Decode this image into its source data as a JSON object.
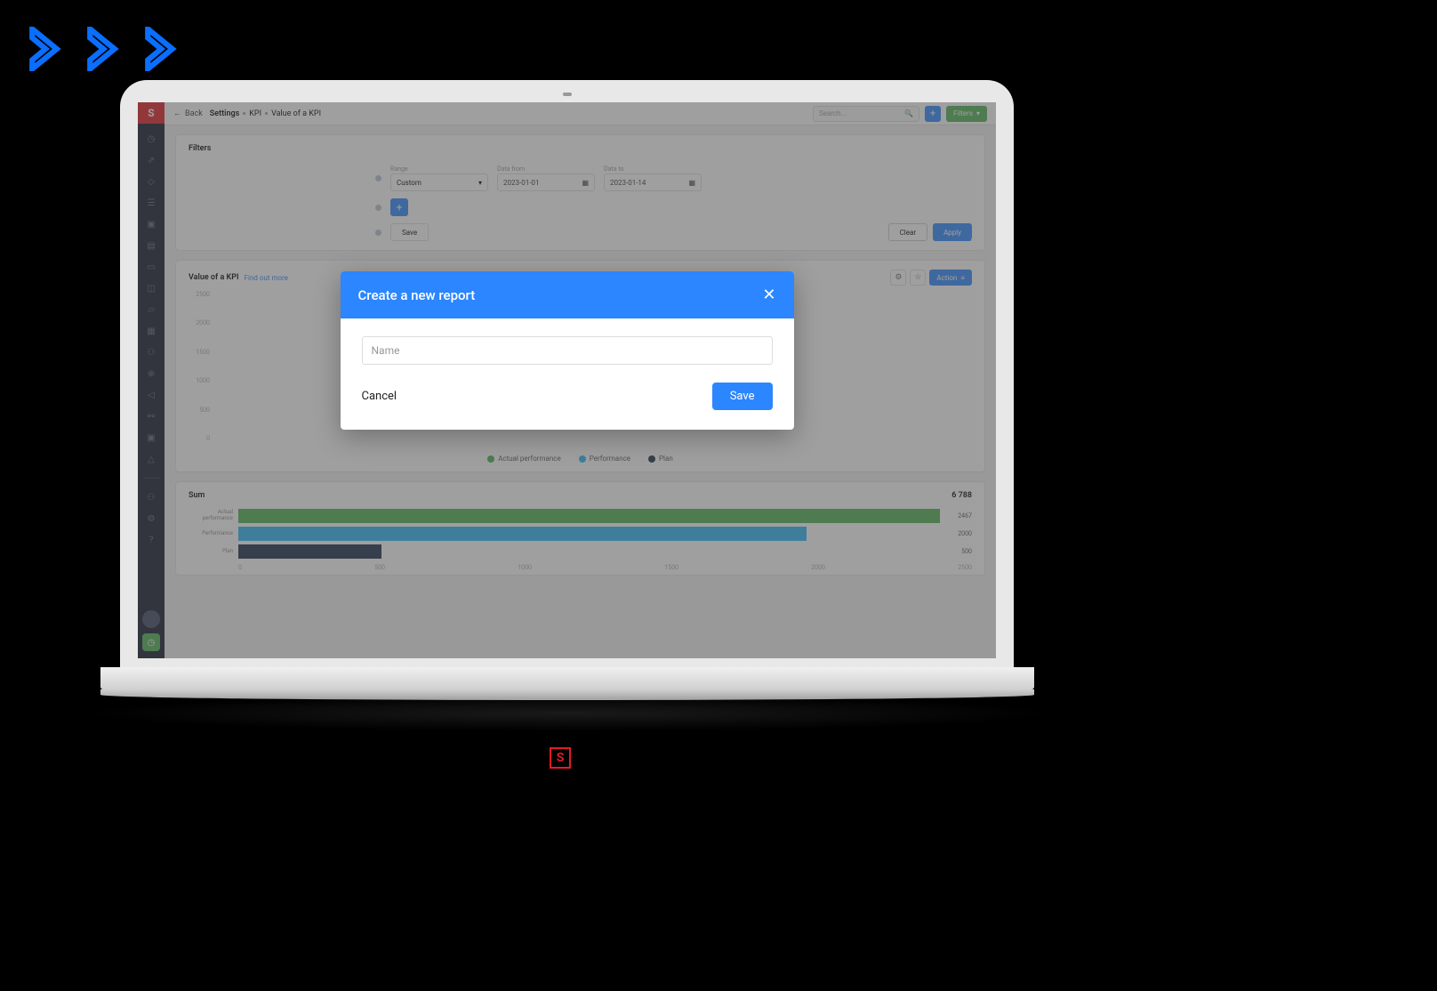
{
  "topbar": {
    "back": "Back",
    "crumb1": "Settings",
    "crumb2": "KPI",
    "crumb3": "Value of a KPI",
    "search_placeholder": "Search...",
    "filters_btn": "Filters"
  },
  "filters": {
    "title": "Filters",
    "range_label": "Range",
    "range_value": "Custom",
    "from_label": "Data from",
    "from_value": "2023-01-01",
    "to_label": "Data to",
    "to_value": "2023-01-14",
    "save": "Save",
    "clear": "Clear",
    "apply": "Apply"
  },
  "kpi": {
    "title": "Value of a KPI",
    "find": "Find out more",
    "action": "Action",
    "y_ticks": [
      "2500",
      "2000",
      "1500",
      "1000",
      "500",
      "0"
    ],
    "legend": [
      {
        "label": "Actual performance",
        "color": "#4caf50"
      },
      {
        "label": "Performance",
        "color": "#29b6f6"
      },
      {
        "label": "Plan",
        "color": "#1a2847"
      }
    ]
  },
  "sum": {
    "title": "Sum",
    "total": "6 788",
    "x_ticks": [
      "0",
      "500",
      "1000",
      "1500",
      "2000",
      "2500"
    ]
  },
  "chart_data": {
    "type": "bar",
    "orientation": "horizontal",
    "title": "Sum",
    "xlabel": "",
    "ylabel": "",
    "xlim": [
      0,
      2500
    ],
    "categories": [
      "Actual performance",
      "Performance",
      "Plan"
    ],
    "values": [
      2467,
      2000,
      500
    ],
    "colors": [
      "#4caf50",
      "#29b6f6",
      "#1a2847"
    ],
    "total": 6788
  },
  "modal": {
    "title": "Create a new report",
    "name_placeholder": "Name",
    "cancel": "Cancel",
    "save": "Save"
  }
}
